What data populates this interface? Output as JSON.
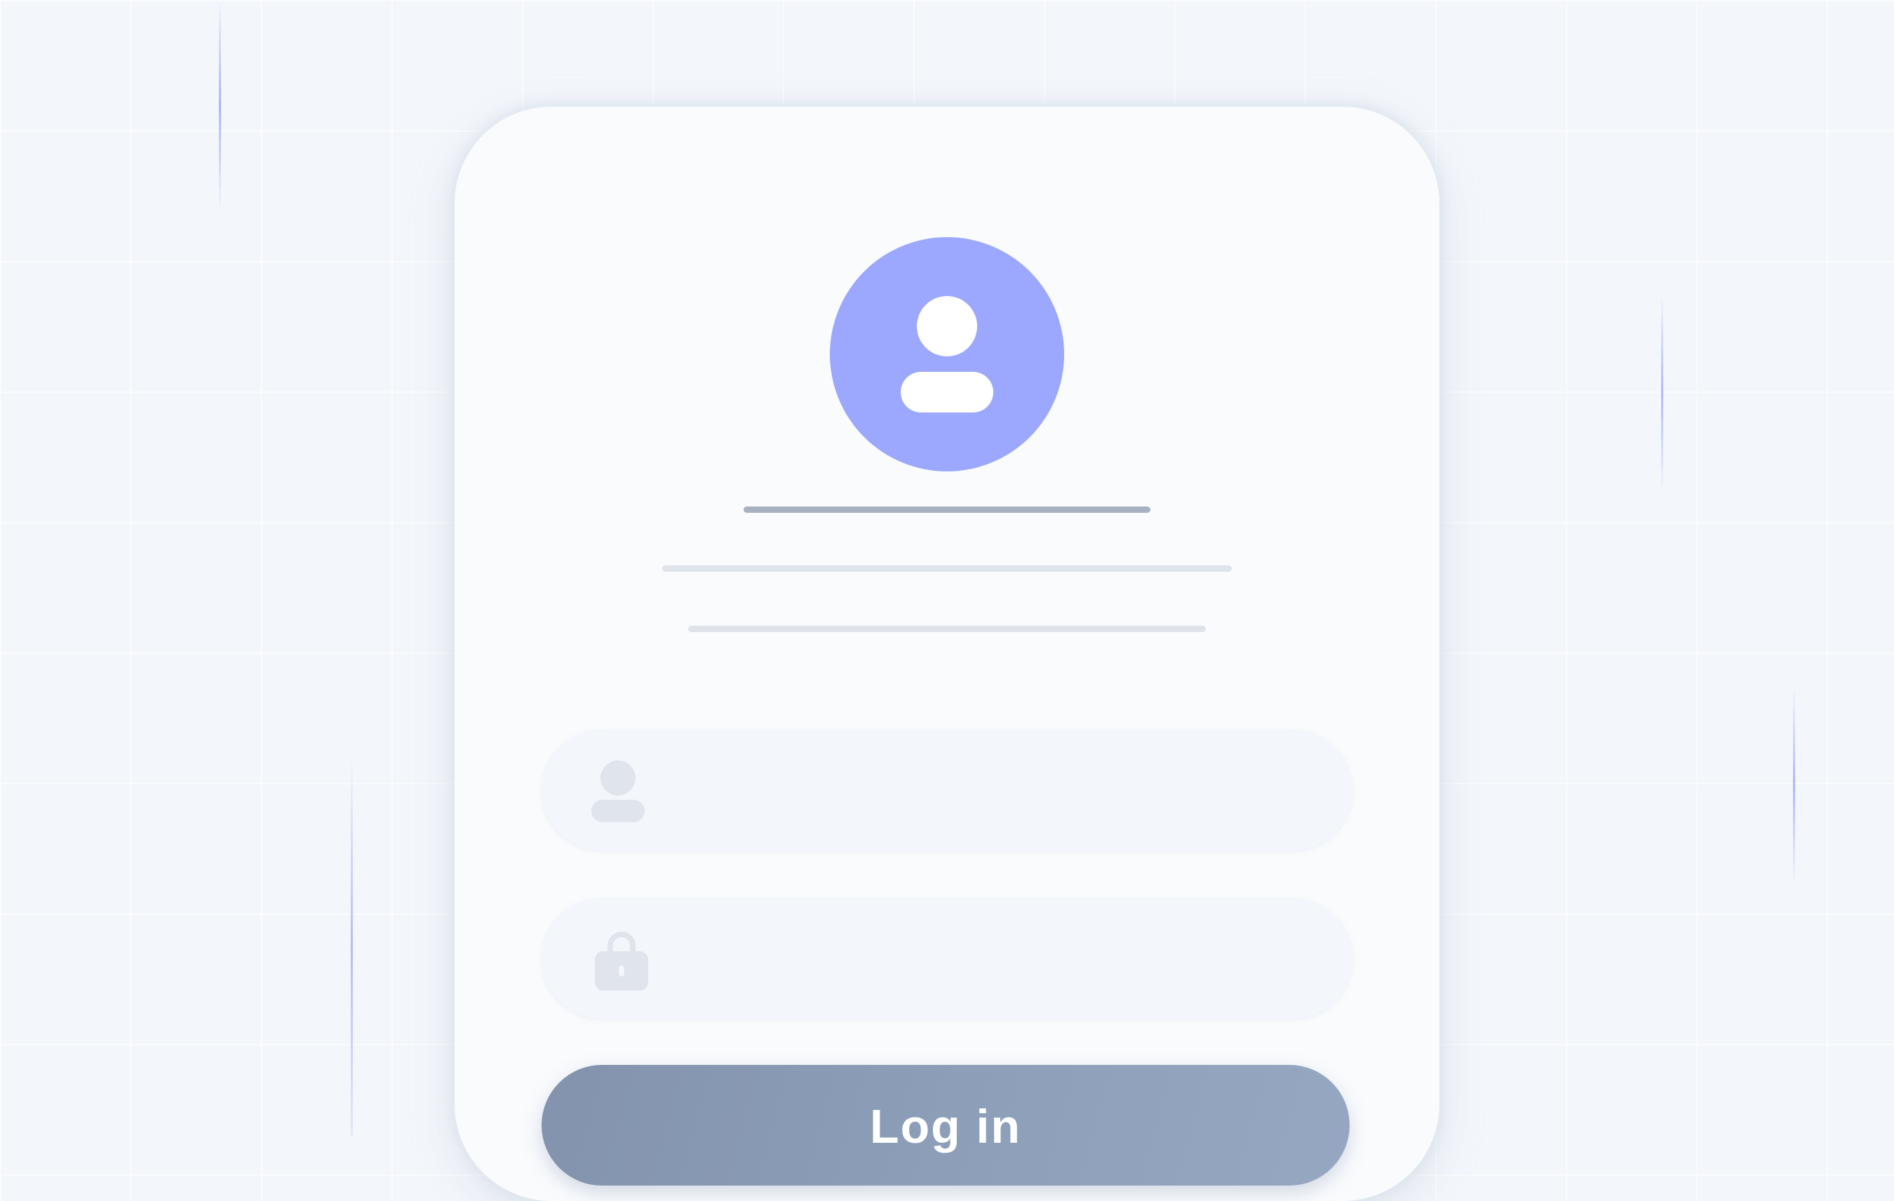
{
  "login_form": {
    "avatar_icon": "user-icon",
    "username_field": {
      "icon": "user-icon",
      "value": "",
      "placeholder": ""
    },
    "password_field": {
      "icon": "lock-icon",
      "value": "",
      "placeholder": ""
    },
    "login_button_label": "Log in"
  },
  "colors": {
    "accent": "#9ba8fe",
    "background": "#f3f6fb",
    "card": "#f9fbfd",
    "button": "#8a9bb6",
    "icon_muted": "#e0e4ec",
    "title_line": "#a7b1c2",
    "subtitle_line": "#dfe4ea"
  }
}
